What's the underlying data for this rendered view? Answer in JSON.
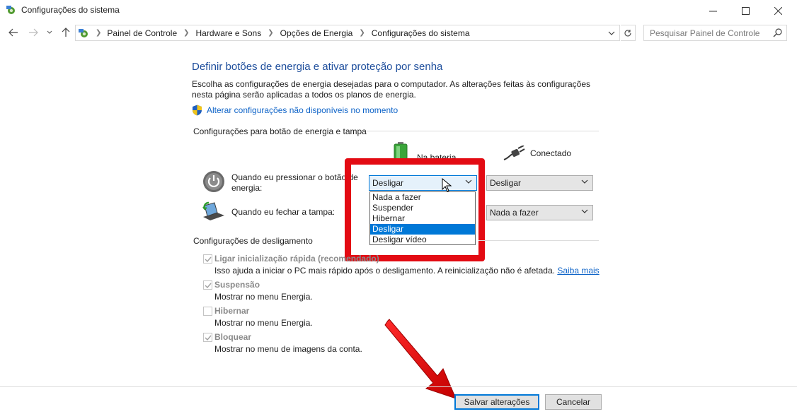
{
  "window": {
    "title": "Configurações do sistema"
  },
  "address": {
    "crumbs": [
      "Painel de Controle",
      "Hardware e Sons",
      "Opções de Energia",
      "Configurações do sistema"
    ],
    "search_placeholder": "Pesquisar Painel de Controle"
  },
  "main": {
    "heading": "Definir botões de energia e ativar proteção por senha",
    "intro": "Escolha as configurações de energia desejadas para o computador. As alterações feitas às configurações nesta página serão aplicadas a todos os planos de energia.",
    "unavailable_link": "Alterar configurações não disponíveis no momento",
    "power_group": "Configurações para botão de energia e tampa",
    "col_battery": "Na bateria",
    "col_plugged": "Conectado",
    "rows": [
      {
        "label": "Quando eu pressionar o botão de energia:",
        "battery": "Desligar",
        "plugged": "Desligar"
      },
      {
        "label": "Quando eu fechar a tampa:",
        "battery": "Nada a fazer",
        "plugged": "Nada a fazer"
      }
    ],
    "dropdown_options": [
      "Nada a fazer",
      "Suspender",
      "Hibernar",
      "Desligar",
      "Desligar vídeo"
    ],
    "dropdown_selected": "Desligar",
    "shutdown_group": "Configurações de desligamento",
    "shutdown_items": [
      {
        "label": "Ligar inicialização rápida (recomendado)",
        "desc": "Isso ajuda a iniciar o PC mais rápido após o desligamento. A reinicialização não é afetada.",
        "link": "Saiba mais",
        "checked": true
      },
      {
        "label": "Suspensão",
        "desc": "Mostrar no menu Energia.",
        "checked": true
      },
      {
        "label": "Hibernar",
        "desc": "Mostrar no menu Energia.",
        "checked": false
      },
      {
        "label": "Bloquear",
        "desc": "Mostrar no menu de imagens da conta.",
        "checked": true
      }
    ]
  },
  "buttons": {
    "save": "Salvar alterações",
    "cancel": "Cancelar"
  },
  "colors": {
    "accent": "#0078d7",
    "link": "#0f64c8",
    "annotation_red": "#e30b13"
  }
}
